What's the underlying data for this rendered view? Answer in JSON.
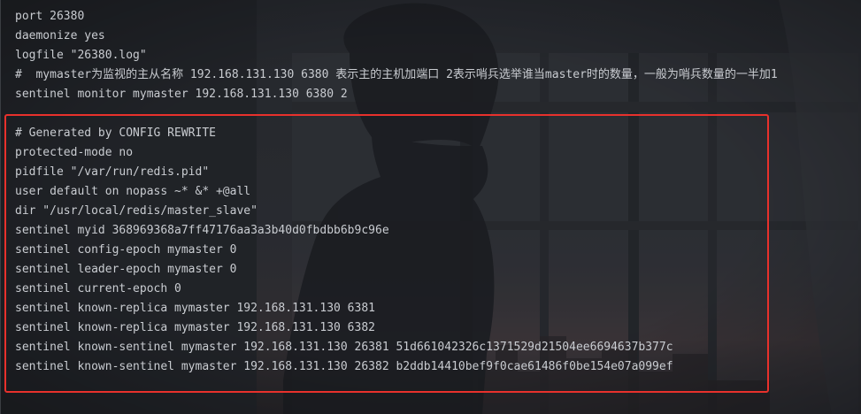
{
  "editor": {
    "lines": [
      "port 26380",
      "daemonize yes",
      "logfile \"26380.log\"",
      "#  mymaster为监视的主从名称 192.168.131.130 6380 表示主的主机加端口 2表示哨兵选举谁当master时的数量，一般为哨兵数量的一半加1",
      "sentinel monitor mymaster 192.168.131.130 6380 2",
      "",
      "# Generated by CONFIG REWRITE",
      "protected-mode no",
      "pidfile \"/var/run/redis.pid\"",
      "user default on nopass ~* &* +@all",
      "dir \"/usr/local/redis/master_slave\"",
      "sentinel myid 368969368a7ff47176aa3a3b40d0fbdbb6b9c96e",
      "sentinel config-epoch mymaster 0",
      "sentinel leader-epoch mymaster 0",
      "sentinel current-epoch 0",
      "sentinel known-replica mymaster 192.168.131.130 6381",
      "sentinel known-replica mymaster 192.168.131.130 6382",
      "sentinel known-sentinel mymaster 192.168.131.130 26381 51d661042326c1371529d21504ee6694637b377c",
      "sentinel known-sentinel mymaster 192.168.131.130 26382 b2ddb14410bef9f0cae61486f0be154e07a099ef"
    ]
  },
  "colors": {
    "text": "#c9ccd1",
    "highlight_border": "#e8312c",
    "background": "#25272b"
  },
  "wallpaper": {
    "subject": "girl-silhouette-by-window"
  }
}
